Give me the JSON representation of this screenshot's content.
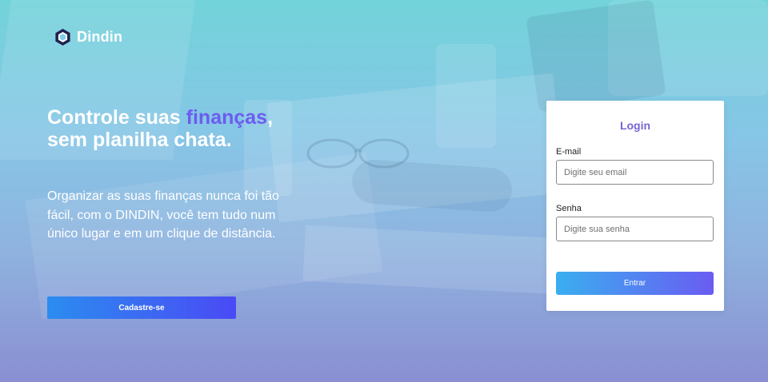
{
  "brand": {
    "name": "Dindin",
    "icon": "hexagon-logo-icon",
    "logo_color": "#1f2250"
  },
  "hero": {
    "headline_before": "Controle suas ",
    "headline_accent": "finanças",
    "headline_after": ",",
    "headline_line2": "sem planilha chata.",
    "description": "Organizar as suas finanças nunca foi tão fácil, com o DINDIN, você tem tudo num único lugar e em um clique de distância.",
    "signup_label": "Cadastre-se"
  },
  "login": {
    "title": "Login",
    "email_label": "E-mail",
    "email_placeholder": "Digite seu email",
    "email_value": "",
    "password_label": "Senha",
    "password_placeholder": "Digite sua senha",
    "password_value": "",
    "submit_label": "Entrar"
  },
  "colors": {
    "accent": "#6d5cf0",
    "login_title": "#7466d4",
    "button_gradient_start": "#2b8cf0",
    "button_gradient_end": "#4a4af5"
  }
}
